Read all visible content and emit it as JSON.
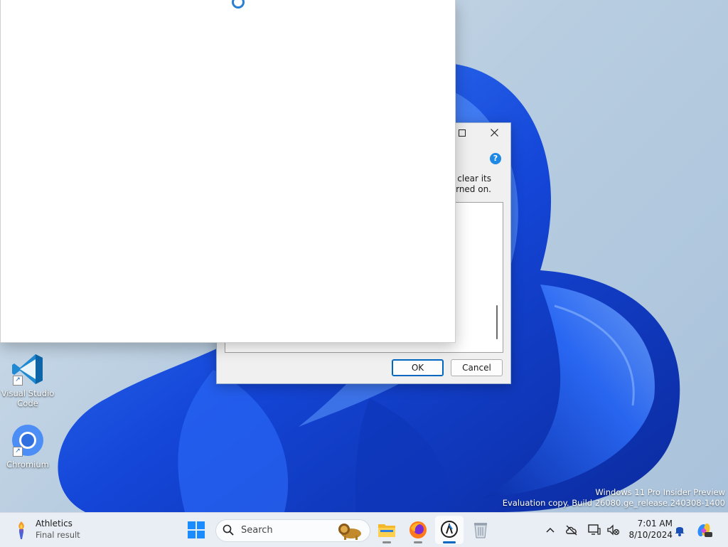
{
  "desktop": {
    "icons": [
      {
        "label": "Visual Studio Code",
        "icon": "vscode-icon"
      },
      {
        "label": "Chromium",
        "icon": "chromium-icon"
      }
    ],
    "watermark": {
      "line1": "Windows 11 Pro Insider Preview",
      "line2": "Evaluation copy. Build 26080.ge_release.240308-1400"
    }
  },
  "dialog": {
    "maximize_icon": "maximize-icon",
    "close_icon": "close-icon",
    "help_badge": "?",
    "text_line1": ". clear its",
    "text_line2": "urned on.",
    "ok_label": "OK",
    "cancel_label": "Cancel"
  },
  "taskbar": {
    "weather": {
      "title": "Athletics",
      "subtitle": "Final result"
    },
    "search": {
      "label": "Search"
    },
    "apps": [
      {
        "name": "start-button",
        "icon": "windows-logo-icon"
      },
      {
        "name": "file-explorer",
        "icon": "folder-icon"
      },
      {
        "name": "firefox",
        "icon": "firefox-icon"
      },
      {
        "name": "active-app",
        "icon": "app-icon",
        "active": true
      },
      {
        "name": "recycle-bin-app",
        "icon": "recycle-bin-icon"
      }
    ],
    "tray": {
      "time": "7:01 AM",
      "date": "8/10/2024"
    }
  },
  "colors": {
    "accent": "#0067c0",
    "wallpaper_blue": "#1a4fe0"
  }
}
